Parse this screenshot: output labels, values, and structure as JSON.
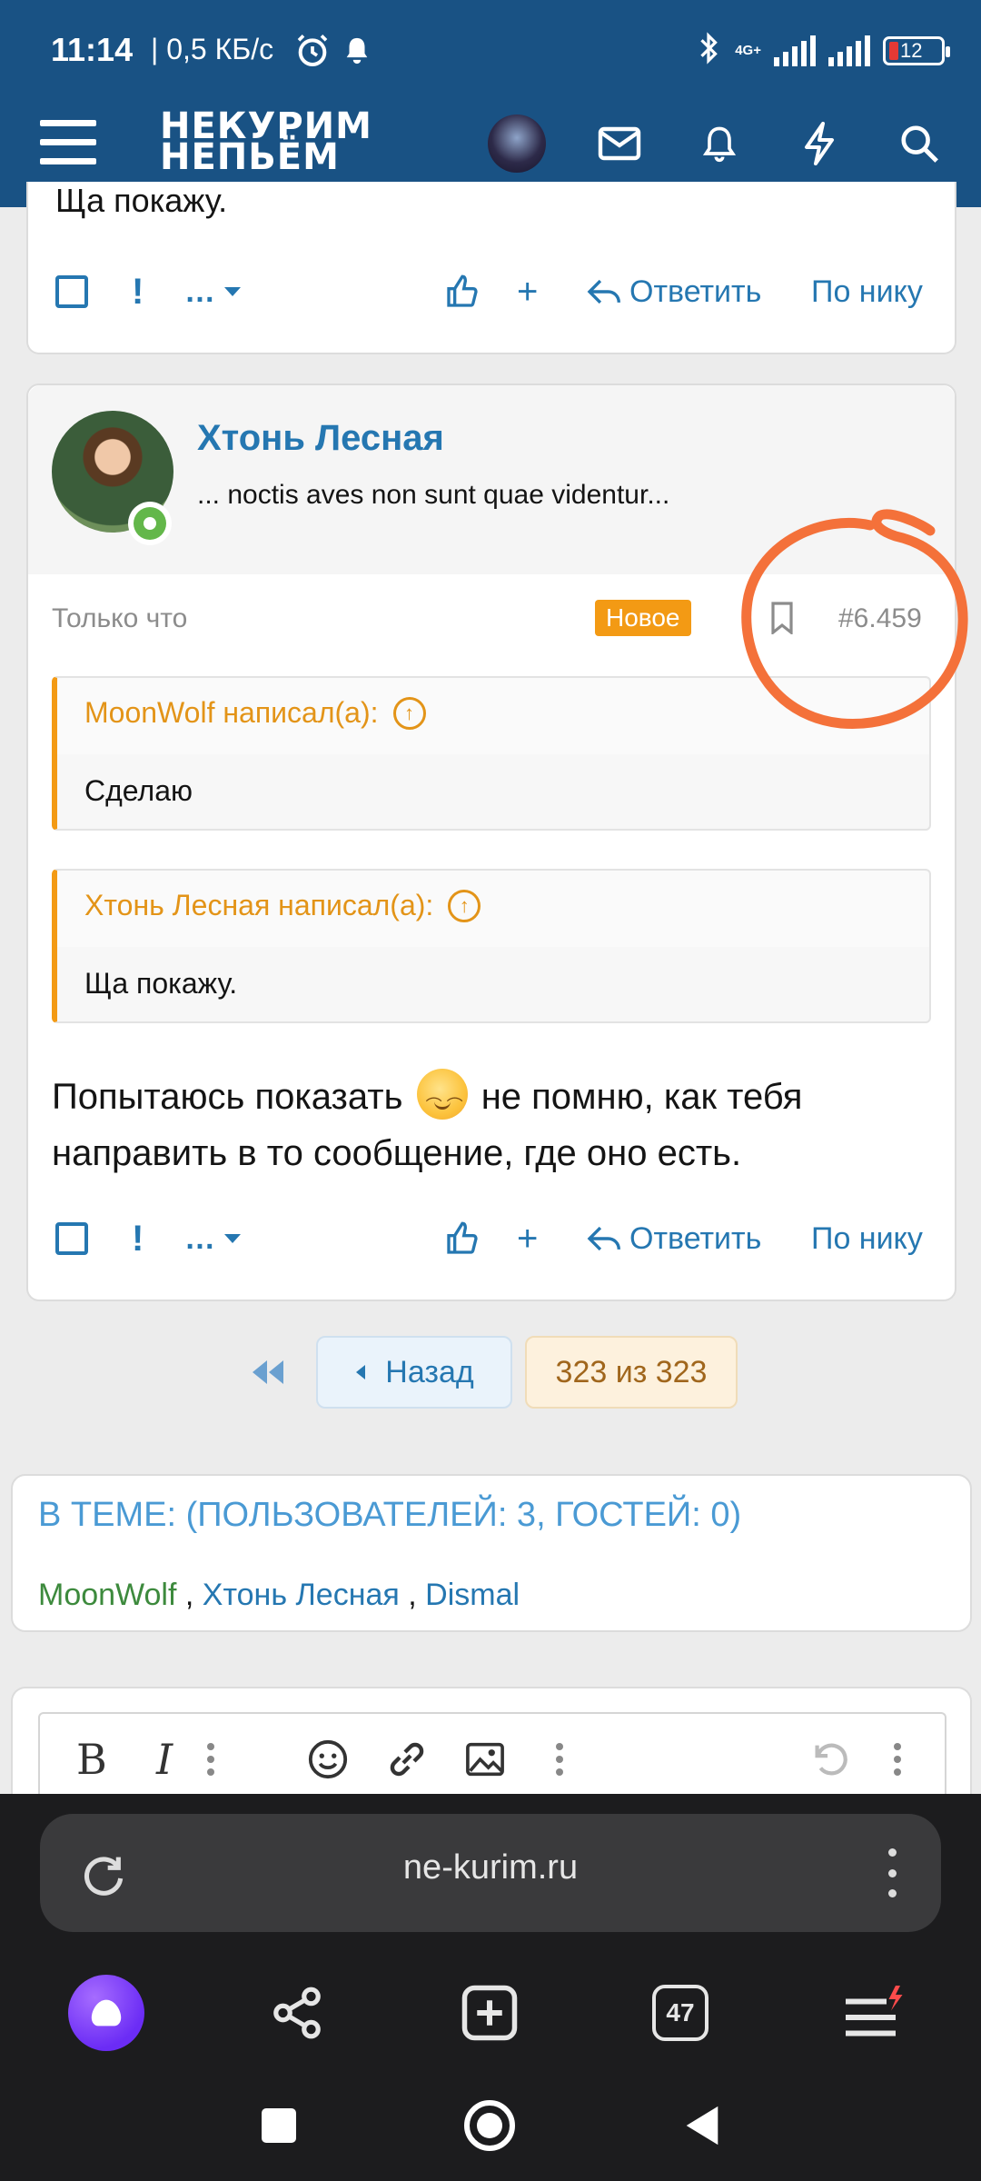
{
  "status_bar": {
    "time": "11:14",
    "speed": "| 0,5 КБ/с",
    "network": "4G+",
    "battery": "12"
  },
  "header": {
    "logo_line1": "НЕКУРИМ",
    "logo_line2": "НЕПЬЁМ"
  },
  "prev_post": {
    "cut_text": "Ща покажу."
  },
  "actions": {
    "react_more": "…",
    "add": "+",
    "reply": "Ответить",
    "by_nick": "По нику"
  },
  "post": {
    "author": "Хтонь Лесная",
    "user_title": "... noctis aves non sunt quae videntur...",
    "date": "Только что",
    "badge": "Новое",
    "number": "#6.459",
    "quotes": [
      {
        "author": "MoonWolf написал(а):",
        "text": "Сделаю"
      },
      {
        "author": "Хтонь Лесная написал(а):",
        "text": "Ща покажу."
      }
    ],
    "body_part1": "Попытаюсь показать",
    "body_part2": "не помню, как тебя направить в то сообщение, где оно есть."
  },
  "pagination": {
    "back": "Назад",
    "current": "323 из 323"
  },
  "online": {
    "title": "В ТЕМЕ: (ПОЛЬЗОВАТЕЛЕЙ: 3, ГОСТЕЙ: 0)",
    "users": [
      "MoonWolf",
      "Хтонь Лесная",
      "Dismal"
    ],
    "separator": " , "
  },
  "editor": {
    "bold": "B",
    "italic": "I"
  },
  "browser": {
    "url": "ne-kurim.ru",
    "tabs_count": "47"
  },
  "colors": {
    "header_bg": "#195284",
    "link": "#2577b1",
    "accent_orange": "#f39a14",
    "annotation": "#f4713a"
  }
}
